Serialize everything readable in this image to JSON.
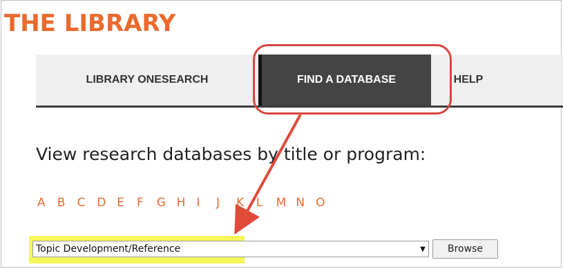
{
  "site": {
    "title": "THE LIBRARY"
  },
  "nav": {
    "tabs": [
      {
        "label": "LIBRARY ONESEARCH"
      },
      {
        "label": "FIND A DATABASE"
      },
      {
        "label": "HELP"
      }
    ]
  },
  "main": {
    "heading": "View research databases by title or program:",
    "az_letters": [
      "A",
      "B",
      "C",
      "D",
      "E",
      "F",
      "G",
      "H",
      "I",
      "J",
      "K",
      "L",
      "M",
      "N",
      "O"
    ],
    "program_select": {
      "value": "Topic Development/Reference"
    },
    "browse_label": "Browse"
  },
  "annotation": {
    "ring_color": "#d6453f",
    "arrow_color": "#e04a3b",
    "highlight_color": "#f6f65a"
  },
  "colors": {
    "accent": "#ea6a2e",
    "active_tab": "#444444"
  }
}
